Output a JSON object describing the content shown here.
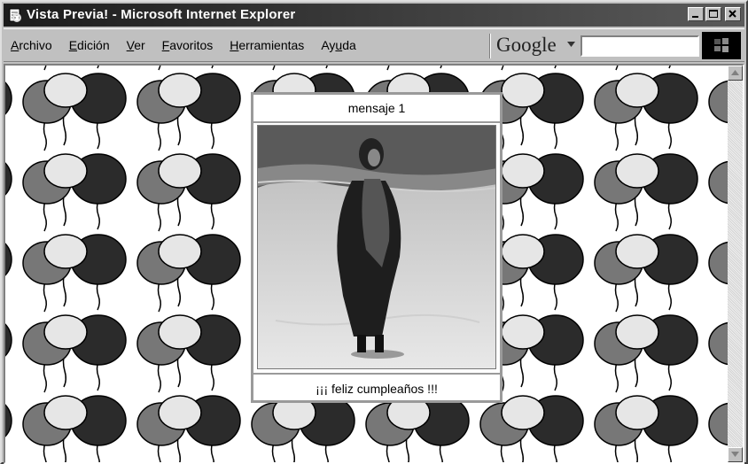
{
  "window": {
    "title": "Vista Previa! - Microsoft Internet Explorer",
    "icon": "ie-page-icon",
    "controls": [
      "minimize-icon",
      "maximize-icon",
      "close-icon"
    ]
  },
  "menubar": {
    "items": [
      {
        "pre": "",
        "key": "A",
        "post": "rchivo"
      },
      {
        "pre": "",
        "key": "E",
        "post": "dición"
      },
      {
        "pre": "",
        "key": "V",
        "post": "er"
      },
      {
        "pre": "",
        "key": "F",
        "post": "avoritos"
      },
      {
        "pre": "",
        "key": "H",
        "post": "erramientas"
      },
      {
        "pre": "Ay",
        "key": "u",
        "post": "da"
      }
    ]
  },
  "google_toolbar": {
    "logo": "Google",
    "search_value": ""
  },
  "popup": {
    "header": "mensaje 1",
    "footer": "¡¡¡ feliz cumpleaños !!!"
  },
  "colors": {
    "titlebar": "#2a2a2a",
    "chrome": "#c0c0c0",
    "balloon_dark": "#2b2b2b",
    "balloon_mid": "#777777",
    "balloon_light": "#e6e6e6"
  }
}
